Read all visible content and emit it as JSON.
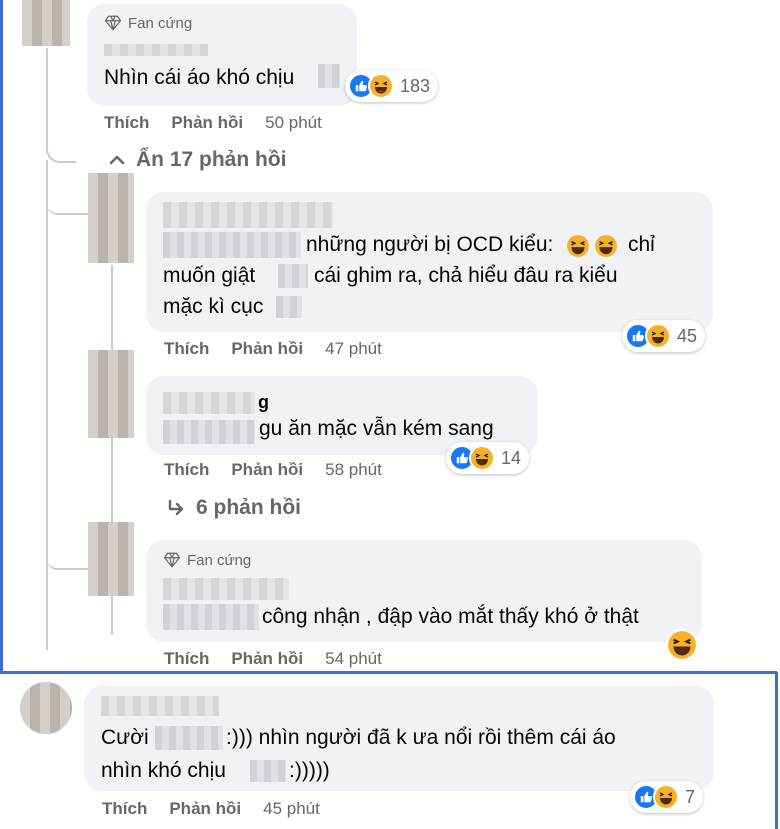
{
  "colors": {
    "like": "#1877f2",
    "haha": "#f7b125",
    "bubble": "#f0f2f5",
    "muted": "#65676b",
    "frame": "#3b6fd6"
  },
  "actions": {
    "like": "Thích",
    "reply": "Phản hồi"
  },
  "comments": [
    {
      "badge": "Fan cứng",
      "text": "Nhìn cái áo khó chịu",
      "reactions": "183",
      "time": "50 phút"
    },
    {
      "lines": [
        "những người bị OCD kiểu:",
        "muốn giật",
        "cái ghim ra, chả hiểu đâu ra kiểu",
        "mặc kì cục"
      ],
      "partial": "chỉ",
      "reactions": "45",
      "time": "47 phút"
    },
    {
      "name_tail": "g",
      "text": "gu ăn mặc vẫn kém sang",
      "reactions": "14",
      "time": "58 phút"
    },
    {
      "badge": "Fan cứng",
      "text": "công nhận , đập vào mắt thấy khó ở thật",
      "time": "54 phút"
    },
    {
      "lines": [
        "Cười",
        ":))) nhìn người đã k ưa nổi rồi thêm cái áo",
        "nhìn khó chịu",
        ":)))))"
      ],
      "reactions": "7",
      "time": "45 phút"
    }
  ],
  "toggles": {
    "hide_replies": "Ẩn 17 phản hồi",
    "view_replies": "6 phản hồi"
  },
  "icons": [
    "diamond-icon",
    "like-icon",
    "haha-icon",
    "chevron-up-icon",
    "reply-arrow-icon"
  ]
}
